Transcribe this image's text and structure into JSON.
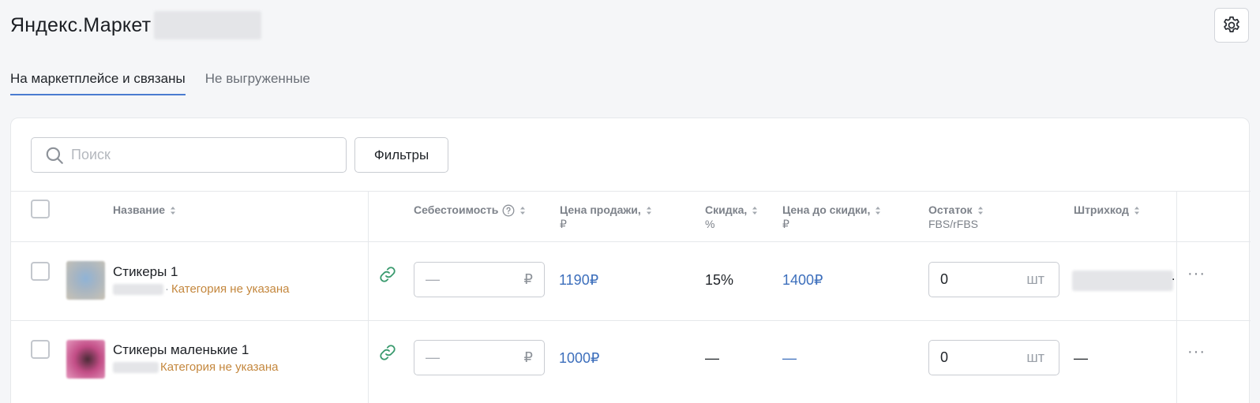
{
  "header": {
    "title": "Яндекс.Маркет"
  },
  "tabs": [
    {
      "label": "На маркетплейсе и связаны",
      "active": true
    },
    {
      "label": "Не выгруженные",
      "active": false
    }
  ],
  "toolbar": {
    "search_placeholder": "Поиск",
    "filters_label": "Фильтры"
  },
  "table": {
    "columns": {
      "name": "Название",
      "cost": "Себестоимость",
      "sale_price": "Цена продажи,",
      "sale_price_sub": "₽",
      "discount": "Скидка,",
      "discount_sub": "%",
      "price_before": "Цена до скидки,",
      "price_before_sub": "₽",
      "stock": "Остаток",
      "stock_sub": "FBS/rFBS",
      "barcode": "Штрихкод"
    },
    "rows": [
      {
        "name": "Стикеры 1",
        "category": "Категория не указана",
        "cost_placeholder": "—",
        "currency": "₽",
        "sale_price": "1190₽",
        "discount": "15%",
        "price_before": "1400₽",
        "stock": "0",
        "stock_unit": "шт",
        "barcode_suffix": "."
      },
      {
        "name": "Стикеры маленькие 1",
        "category": "Категория не указана",
        "cost_placeholder": "—",
        "currency": "₽",
        "sale_price": "1000₽",
        "discount": "—",
        "price_before": "—",
        "stock": "0",
        "stock_unit": "шт",
        "barcode": "—"
      }
    ]
  },
  "colors": {
    "accent": "#4a7bd0",
    "link": "#3d6fbc",
    "category": "#c4873d",
    "link_icon": "#3a9a6e"
  }
}
